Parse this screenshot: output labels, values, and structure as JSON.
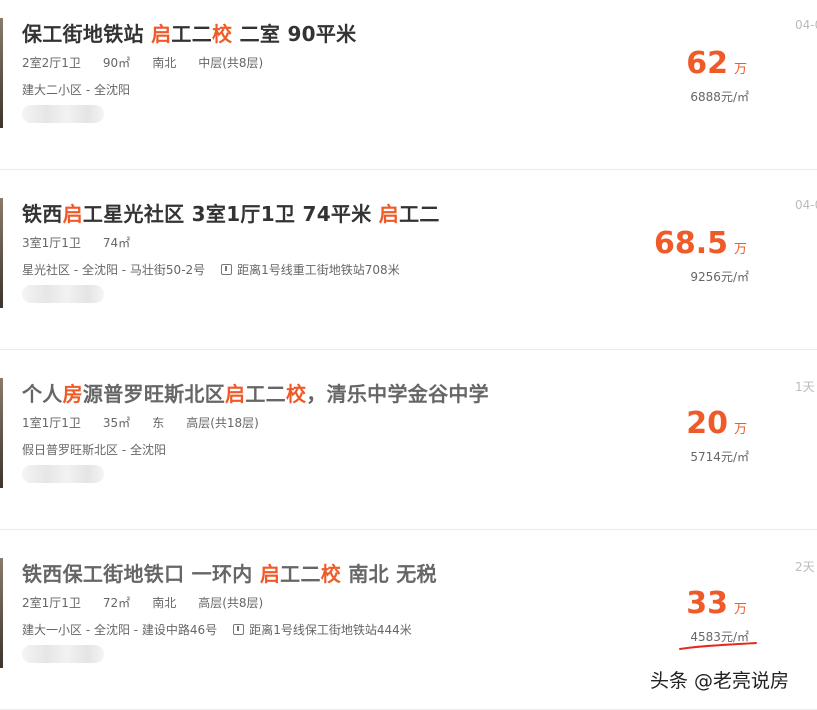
{
  "listings": [
    {
      "title": [
        {
          "t": "保工街地铁站 "
        },
        {
          "t": "启",
          "hl": true
        },
        {
          "t": "工二"
        },
        {
          "t": "校",
          "hl": true
        },
        {
          "t": " 二室 90平米"
        }
      ],
      "dim": false,
      "attrs": [
        "2室2厅1卫",
        "90㎡",
        "南北",
        "中层(共8层)"
      ],
      "location": "建大二小区 - 全沈阳",
      "metro": "",
      "price": "62",
      "price_unit": "万",
      "unit_price": "6888元/㎡",
      "date": "04-0"
    },
    {
      "title": [
        {
          "t": "铁西"
        },
        {
          "t": "启",
          "hl": true
        },
        {
          "t": "工星光社区 3室1厅1卫 74平米 "
        },
        {
          "t": "启",
          "hl": true
        },
        {
          "t": "工二"
        }
      ],
      "dim": false,
      "attrs": [
        "3室1厅1卫",
        "74㎡"
      ],
      "location": "星光社区 - 全沈阳 - 马壮街50-2号",
      "metro": "距离1号线重工街地铁站708米",
      "price": "68.5",
      "price_unit": "万",
      "unit_price": "9256元/㎡",
      "date": "04-0"
    },
    {
      "title": [
        {
          "t": "个人"
        },
        {
          "t": "房",
          "hl": true
        },
        {
          "t": "源普罗旺斯北区"
        },
        {
          "t": "启",
          "hl": true
        },
        {
          "t": "工二"
        },
        {
          "t": "校",
          "hl": true
        },
        {
          "t": "，清乐中学金谷中学"
        }
      ],
      "dim": true,
      "attrs": [
        "1室1厅1卫",
        "35㎡",
        "东",
        "高层(共18层)"
      ],
      "location": "假日普罗旺斯北区 - 全沈阳",
      "metro": "",
      "price": "20",
      "price_unit": "万",
      "unit_price": "5714元/㎡",
      "date": "1天"
    },
    {
      "title": [
        {
          "t": "铁西保工街地铁口 一环内 "
        },
        {
          "t": "启",
          "hl": true
        },
        {
          "t": "工二"
        },
        {
          "t": "校",
          "hl": true
        },
        {
          "t": " 南北 无税"
        }
      ],
      "dim": true,
      "attrs": [
        "2室1厅1卫",
        "72㎡",
        "南北",
        "高层(共8层)"
      ],
      "location": "建大一小区 - 全沈阳 - 建设中路46号",
      "metro": "距离1号线保工街地铁站444米",
      "price": "33",
      "price_unit": "万",
      "unit_price": "4583元/㎡",
      "date": "2天"
    }
  ],
  "watermark": "头条 @老亮说房",
  "colors": {
    "accent": "#ef5a29",
    "annotation": "#e8281e"
  }
}
